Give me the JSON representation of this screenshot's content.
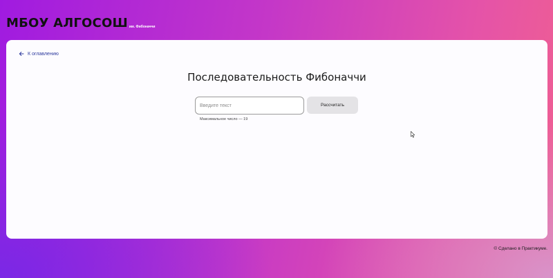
{
  "header": {
    "logo": "МБОУ АЛГОСОШ",
    "logo_sub": "им. Фибоначчи"
  },
  "nav": {
    "back_label": "К оглавлению",
    "back_icon": "arrow-left-icon"
  },
  "main": {
    "title": "Последовательность Фибоначчи",
    "input_placeholder": "Введите текст",
    "input_value": "",
    "button_label": "Рассчитать",
    "hint": "Максимальное число — 19"
  },
  "footer": {
    "text": "© Сделано в Практикуме."
  },
  "colors": {
    "link": "#2d3a9e",
    "card": "#fdfcff",
    "button": "#e4e3e6"
  }
}
